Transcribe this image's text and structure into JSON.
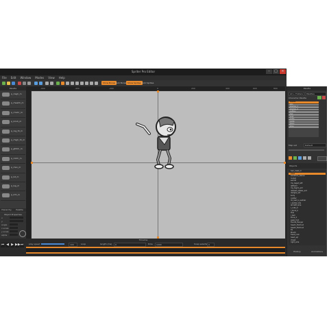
{
  "window": {
    "title": "Spriter Pro Editor",
    "controls": [
      "–",
      "□",
      "×"
    ]
  },
  "menu": [
    "File",
    "Edit",
    "Window",
    "Modes",
    "View",
    "Help"
  ],
  "toolbar": {
    "buttons": [
      "Show Bones",
      "Lock Bones",
      "Show Sprites",
      "Lock Sprites"
    ],
    "active": [
      true,
      false,
      true,
      false
    ]
  },
  "left_panel": {
    "title": "Palette",
    "items": [
      "p_rlegh_m",
      "p_rheahh_m",
      "p_rmohr_m",
      "p_lmoh_m",
      "p_rsg_ht_m",
      "p_rhigh_ht_m",
      "p_gthhh_m",
      "p_rlohh_m",
      "p_rlwn_m",
      "p_lst_m",
      "p_lsg_m",
      "p_lrth_m"
    ],
    "tabs": [
      "Hierarchy",
      "Palette"
    ],
    "props_title": "Object Properties",
    "props": [
      "x",
      "y",
      "angle",
      "x scale",
      "y scale",
      "alpha"
    ]
  },
  "ruler": {
    "ticks": [
      "-600",
      "-400",
      "-200",
      "0",
      "200",
      "400",
      "600",
      "800"
    ]
  },
  "right_panel": {
    "title": "Palette",
    "fields": [
      "All + Folders",
      "Palettes"
    ],
    "swatch_header": "Character Palette",
    "swatches": [
      "Palette",
      "skin",
      "shadow_1",
      "shadow_2",
      "outline",
      "hair",
      "shirt",
      "ankle",
      "pants",
      "jeans",
      "shoe"
    ],
    "selected_swatch": 0,
    "map_label": "Map set",
    "map_value": "Default",
    "objects_title": "Objects",
    "layers": [
      "hair_mask_0",
      "head",
      "sweaters_sleeve",
      "rocket",
      "swimit",
      "my_leged_left",
      "leftheld",
      "my_tagdo_ext",
      "deleset_skates_ext",
      "dedges_ext",
      "body",
      "cadder",
      "lm_lead_a_sadder",
      "l_ladder_bts",
      "armleft_side",
      "l_cobt_m",
      "l_bone_b",
      "skip",
      "l_ball",
      "bone_2",
      "peak_foot",
      "thumb_flanger",
      "head1_ftorfund",
      "head2_ftorfund",
      "tie",
      "Mouth",
      "fresh_look",
      "head_eyl",
      "cheek",
      "right_side"
    ],
    "selected_layer": 1,
    "bottom_tabs": [
      "History",
      "Animations"
    ]
  },
  "timeline": {
    "title": "Timeline",
    "controls": [
      "⏮",
      "◀",
      "▶",
      "▶▶",
      "⏭"
    ],
    "play_speed_label": "play speed",
    "play_speed_value": "100",
    "loop_label": "Loop",
    "length_label": "length (ms)",
    "length_value": "0",
    "time_label": "time",
    "time_value": "1000",
    "snap_label": "Snap selected",
    "snap_value": "0"
  },
  "colors": {
    "accent": "#e8892c",
    "canvas": "#bdbdbd"
  }
}
